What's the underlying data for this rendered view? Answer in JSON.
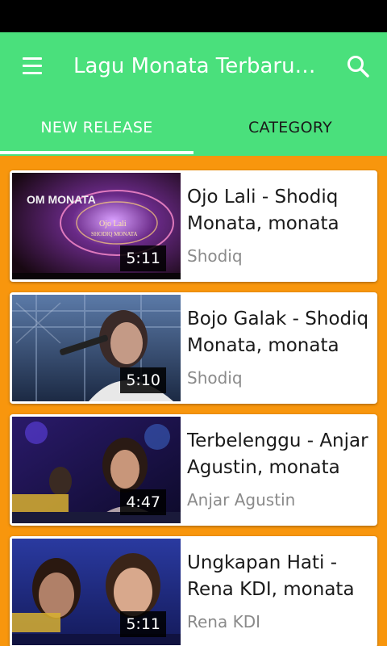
{
  "app": {
    "title": "Lagu Monata Terbaru…",
    "accent_color": "#4ae07c",
    "background_color": "#f8960d"
  },
  "tabs": [
    {
      "label": "NEW RELEASE",
      "selected": true
    },
    {
      "label": "CATEGORY",
      "selected": false
    }
  ],
  "icons": {
    "menu": "hamburger-menu-icon",
    "search": "search-icon"
  },
  "videos": [
    {
      "title": "Ojo Lali - Shodiq Monata, monata",
      "channel": "Shodiq",
      "duration": "5:11",
      "thumb_text": {
        "brand": "OM MONATA",
        "song": "Ojo Lali",
        "artist": "SHODIQ MONATA"
      }
    },
    {
      "title": "Bojo Galak - Shodiq Monata, monata",
      "channel": "Shodiq",
      "duration": "5:10"
    },
    {
      "title": "Terbelenggu - Anjar Agustin, monata",
      "channel": "Anjar Agustin",
      "duration": "4:47"
    },
    {
      "title": "Ungkapan Hati - Rena KDI, monata",
      "channel": "Rena KDI",
      "duration": "5:11"
    }
  ]
}
